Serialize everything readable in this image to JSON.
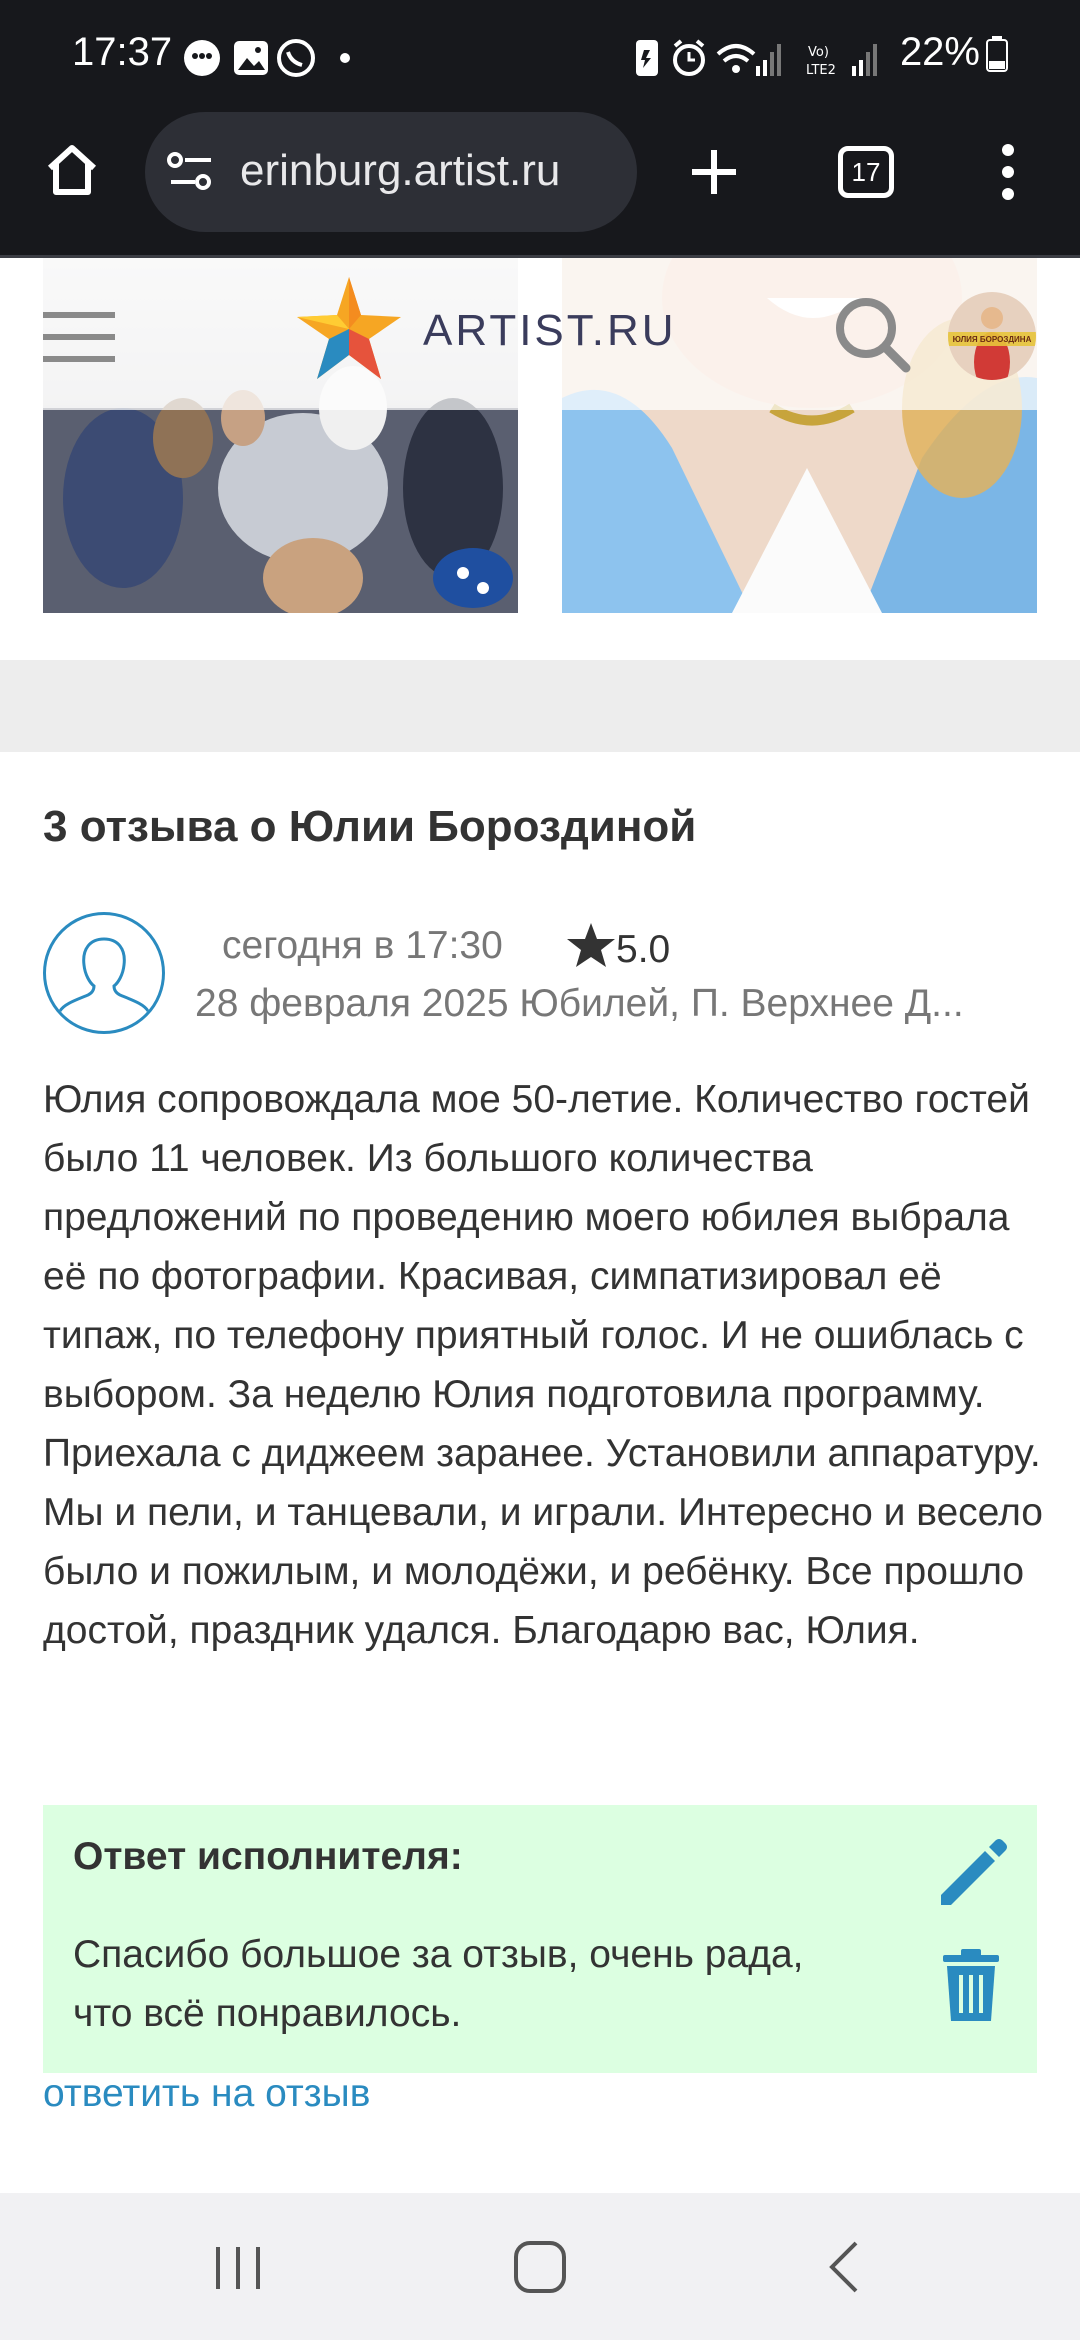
{
  "status_bar": {
    "time": "17:37",
    "battery": "22%",
    "network_label": "Vo) LTE2"
  },
  "browser": {
    "url": "erinburg.artist.ru",
    "tab_count": "17"
  },
  "site": {
    "logo_text": "ARTIST.RU",
    "profile_badge_text": "ЮЛИЯ БОРОЗДИНА"
  },
  "reviews": {
    "heading": "3 отзыва о Юлии Бороздиной",
    "items": [
      {
        "posted": "сегодня в 17:30",
        "rating": "5.0",
        "event": "28 февраля 2025 Юбилей, П. Верхнее Д...",
        "text": "Юлия сопровождала мое 50-летие. Количество гостей было 11 человек. Из большого количества предложений по проведению моего юбилея выбрала её по фотографии. Красивая, симпатизировал её типаж, по телефону приятный голос. И не ошиблась с выбором. За неделю Юлия подготовила программу. Приехала с диджеем заранее. Установили аппаратуру. Мы и пели, и танцевали, и играли. Интересно и весело было и пожилым, и молодёжи, и ребёнку. Все прошло достой, праздник удался. Благодарю вас, Юлия.",
        "answer_title": "Ответ исполнителя:",
        "answer_text": "Спасибо большое за отзыв, очень рада, что всё понравилось.",
        "reply_link": "ответить на отзыв"
      }
    ]
  },
  "colors": {
    "accent_blue": "#2a8bc0",
    "answer_bg": "#dcffe1",
    "system_bar": "#17181c"
  }
}
